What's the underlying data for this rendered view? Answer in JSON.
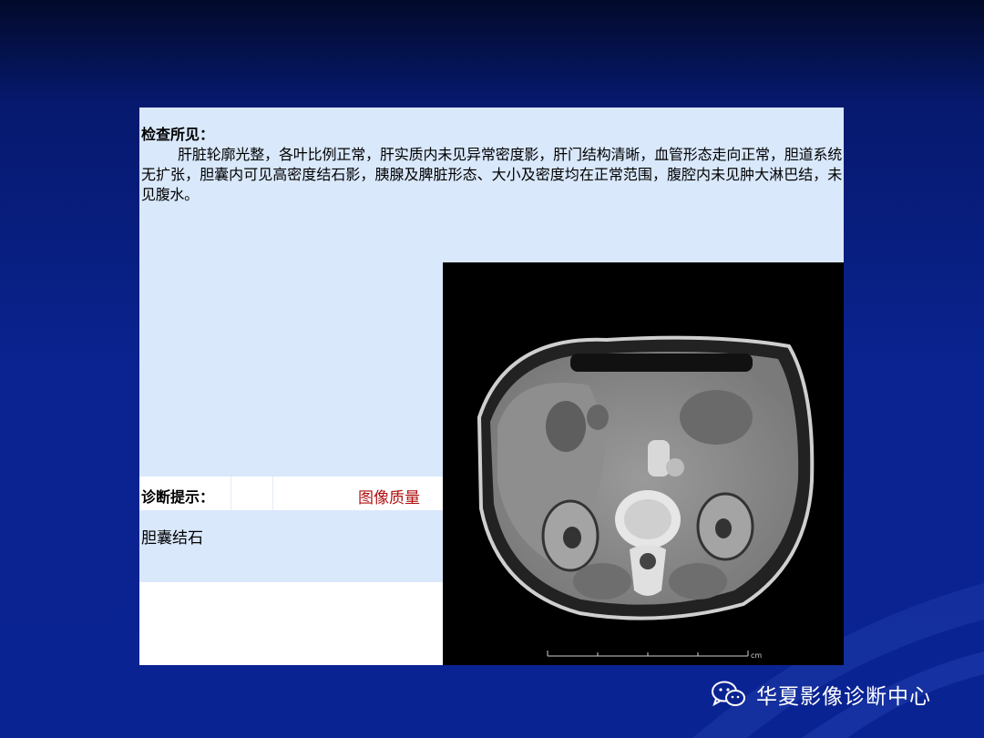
{
  "findings": {
    "heading": "检查所见：",
    "text": "肝脏轮廓光整，各叶比例正常，肝实质内未见异常密度影，肝门结构清晰，血管形态走向正常，胆道系统无扩张，胆囊内可见高密度结石影，胰腺及脾脏形态、大小及密度均在正常范围，腹腔内未见肿大淋巴结，未见腹水。"
  },
  "diagnosis": {
    "heading": "诊断提示：",
    "quality_label": "图像质量",
    "text": "胆囊结石"
  },
  "ct_image": {
    "scale_unit": "cm"
  },
  "brand": {
    "name": "华夏影像诊断中心",
    "icon": "wechat-icon"
  },
  "colors": {
    "background": "#0a2390",
    "panel": "#d9e8fb",
    "quality_text": "#b01010"
  }
}
